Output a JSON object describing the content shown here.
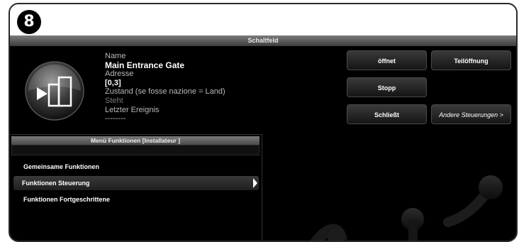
{
  "step_number": "8",
  "panel_title": "Schaltfeld",
  "device": {
    "icon": "gate-icon",
    "name_label": "Name",
    "name_value": "Main Entrance Gate",
    "address_label": "Adresse",
    "address_value": "[0,3]",
    "state_label": "Zustand (se fosse nazione = Land)",
    "state_value": "Steht",
    "last_event_label": "Letzter Ereignis",
    "last_event_value": "--------"
  },
  "buttons": {
    "open": "öffnet",
    "partial_open": "Teilöffnung",
    "stop": "Stopp",
    "close": "Schließt",
    "other_commands": "Andere Steuerungen >"
  },
  "menu": {
    "title": "Menü Funktionen [Installateur ]",
    "items": [
      {
        "label": "Gemeinsame Funktionen"
      },
      {
        "label": "Funktionen Steuerung"
      },
      {
        "label": "Funktionen Fortgeschrittene"
      }
    ]
  },
  "colors": {
    "background": "#000000",
    "title_bar": "#5a5a5a",
    "text": "#ffffff",
    "label_text": "#b9b9b9",
    "frame": "#2a2a2a"
  }
}
